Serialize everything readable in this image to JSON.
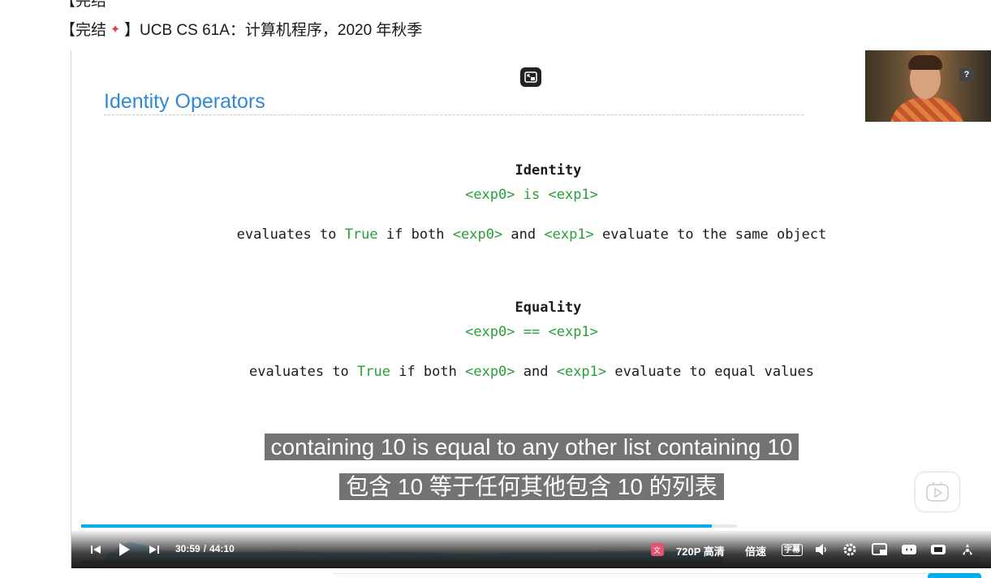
{
  "page": {
    "title_line": "【完结🎉】UCB CS 61A：计算机程序，2020 年秋季",
    "title_prefix": "【完结",
    "title_suffix": "】UCB CS 61A：计算机程序，2020 年秋季"
  },
  "slide": {
    "heading": "Identity Operators",
    "identity_title": "Identity",
    "identity_expr": {
      "left": "<exp0>",
      "op": "is",
      "right": "<exp1>"
    },
    "identity_desc": {
      "a": "evaluates to ",
      "true": "True",
      "b": " if both ",
      "e0": "<exp0>",
      "c": " and ",
      "e1": "<exp1>",
      "d": " evaluate to the same object"
    },
    "equality_title": "Equality",
    "equality_expr": {
      "left": "<exp0>",
      "op": "==",
      "right": "<exp1>"
    },
    "equality_desc": {
      "a": "evaluates to ",
      "true": "True",
      "b": " if both ",
      "e0": "<exp0>",
      "c": " and ",
      "e1": "<exp1>",
      "d": " evaluate to equal values"
    }
  },
  "subtitles": {
    "english": "containing 10 is equal to any other list containing 10",
    "chinese": "包含 10 等于任何其他包含 10 的列表"
  },
  "pip": {
    "help_label": "?"
  },
  "player": {
    "current_time": "30:59",
    "separator": "/",
    "total_time": "44:10",
    "progress_fraction": 0.701,
    "quality_label": "720P 高清",
    "speed_label": "倍速",
    "subtitle_label": "字幕",
    "accent_color": "#00aeec"
  },
  "icons": {
    "prev": "skip-previous-icon",
    "play": "play-icon",
    "next": "skip-next-icon",
    "translate": "translate-icon",
    "volume": "volume-icon",
    "settings": "gear-icon",
    "pip": "picture-in-picture-icon",
    "widescreen": "widescreen-icon",
    "webfull": "web-fullscreen-icon",
    "fullscreen": "fullscreen-icon",
    "danmaku": "danmaku-play-icon"
  }
}
